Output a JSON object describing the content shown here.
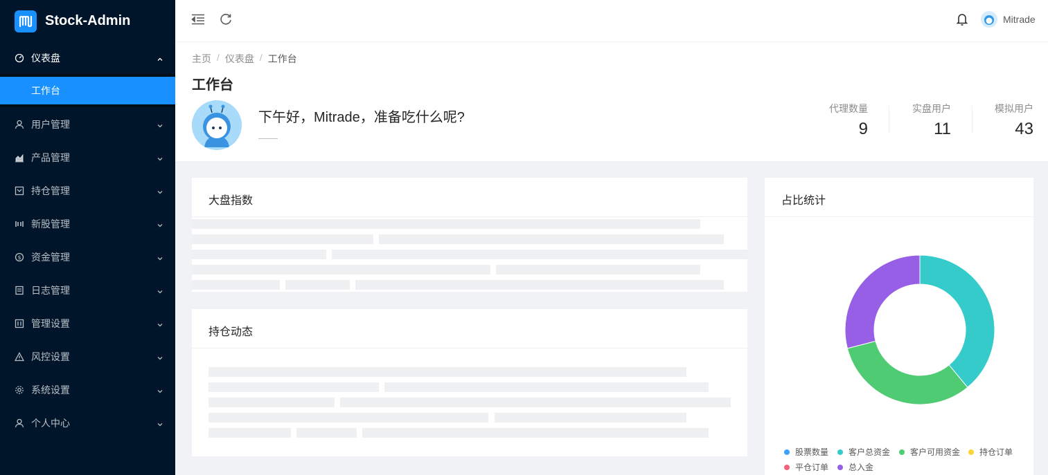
{
  "app": {
    "name": "Stock-Admin"
  },
  "sidebar": {
    "items": [
      {
        "label": "仪表盘",
        "icon": "dashboard-icon"
      },
      {
        "label": "用户管理",
        "icon": "users-icon"
      },
      {
        "label": "产品管理",
        "icon": "area-chart-icon"
      },
      {
        "label": "持仓管理",
        "icon": "position-icon"
      },
      {
        "label": "新股管理",
        "icon": "ipo-icon"
      },
      {
        "label": "资金管理",
        "icon": "dollar-icon"
      },
      {
        "label": "日志管理",
        "icon": "log-icon"
      },
      {
        "label": "管理设置",
        "icon": "settings-panel-icon"
      },
      {
        "label": "风控设置",
        "icon": "warning-icon"
      },
      {
        "label": "系统设置",
        "icon": "gear-icon"
      },
      {
        "label": "个人中心",
        "icon": "user-icon"
      }
    ],
    "sub_item": "工作台"
  },
  "header": {
    "user_name": "Mitrade"
  },
  "breadcrumb": [
    "主页",
    "仪表盘",
    "工作台"
  ],
  "page": {
    "title": "工作台",
    "greeting": "下午好，Mitrade，准备吃什么呢?",
    "stats": [
      {
        "label": "代理数量",
        "value": "9"
      },
      {
        "label": "实盘用户",
        "value": "11"
      },
      {
        "label": "模拟用户",
        "value": "43"
      }
    ]
  },
  "cards": {
    "market_index": "大盘指数",
    "position_feed": "持仓动态",
    "ratio_stats": "占比统计"
  },
  "chart_data": {
    "type": "pie",
    "title": "占比统计",
    "labels": [
      "股票数量",
      "客户总资金",
      "客户可用资金",
      "持仓订单",
      "平仓订单",
      "总入金"
    ],
    "colors": [
      "#3ba1ff",
      "#36cbcb",
      "#4ecb73",
      "#fbd437",
      "#f2637b",
      "#975fe5"
    ],
    "values": [
      0,
      39,
      32,
      0,
      0,
      29
    ],
    "legend_position": "bottom"
  }
}
